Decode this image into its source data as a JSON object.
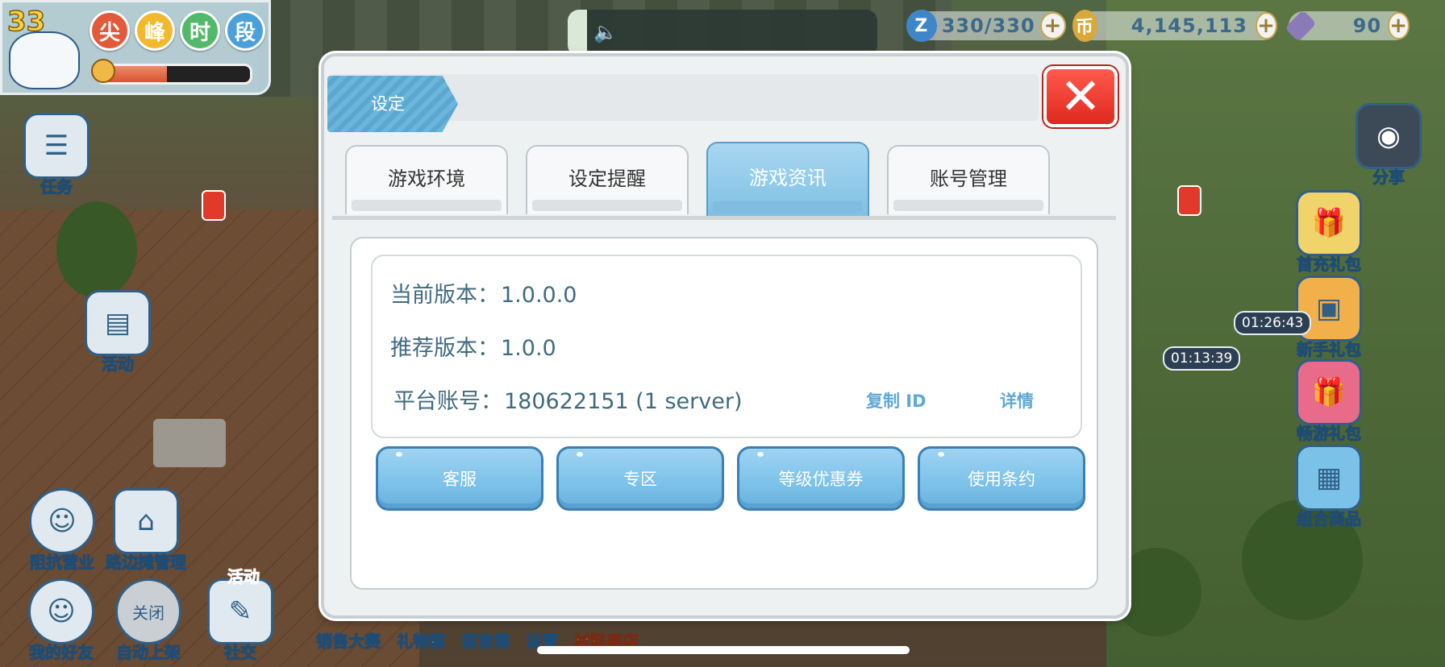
{
  "hud": {
    "level": "33",
    "peak_badges": [
      "尖",
      "峰",
      "时",
      "段"
    ],
    "peak_colors": [
      "#e25a3a",
      "#f2b92e",
      "#52b86a",
      "#4aa0d8"
    ],
    "peak_progress": 0.45,
    "stamina": "330/330",
    "coins": "4,145,113",
    "gems": "90"
  },
  "side_left": [
    {
      "label": "任务"
    },
    {
      "label": "活动"
    },
    {
      "label": "阻抗营业"
    },
    {
      "label": "路边摊管理"
    },
    {
      "label": "我的好友"
    },
    {
      "label": "自动上架"
    },
    {
      "label": "社交"
    }
  ],
  "side_right": [
    {
      "label": "分享"
    },
    {
      "label": "首充礼包"
    },
    {
      "label": "新手礼包"
    },
    {
      "label": "畅游礼包"
    },
    {
      "label": "组合商品"
    }
  ],
  "timers": [
    "01:26:43",
    "01:13:39"
  ],
  "bottom_menu": [
    "销售大赛",
    "礼物箱",
    "留言簿",
    "设置",
    "材料商店"
  ],
  "badge_activity": "活动",
  "badge_close": "关闭",
  "dialog": {
    "title": "设定",
    "tabs": [
      "游戏环境",
      "设定提醒",
      "游戏资讯",
      "账号管理"
    ],
    "active_tab": "游戏资讯",
    "current_version_label": "当前版本：",
    "current_version": "1.0.0.0",
    "recommended_version_label": "推荐版本：",
    "recommended_version": "1.0.0",
    "platform_account_label": "平台账号：",
    "platform_account": "180622151 (1 server)",
    "copy_id": "复制 ID",
    "details": "详情",
    "buttons": [
      "客服",
      "专区",
      "等级优惠券",
      "使用条约"
    ]
  }
}
